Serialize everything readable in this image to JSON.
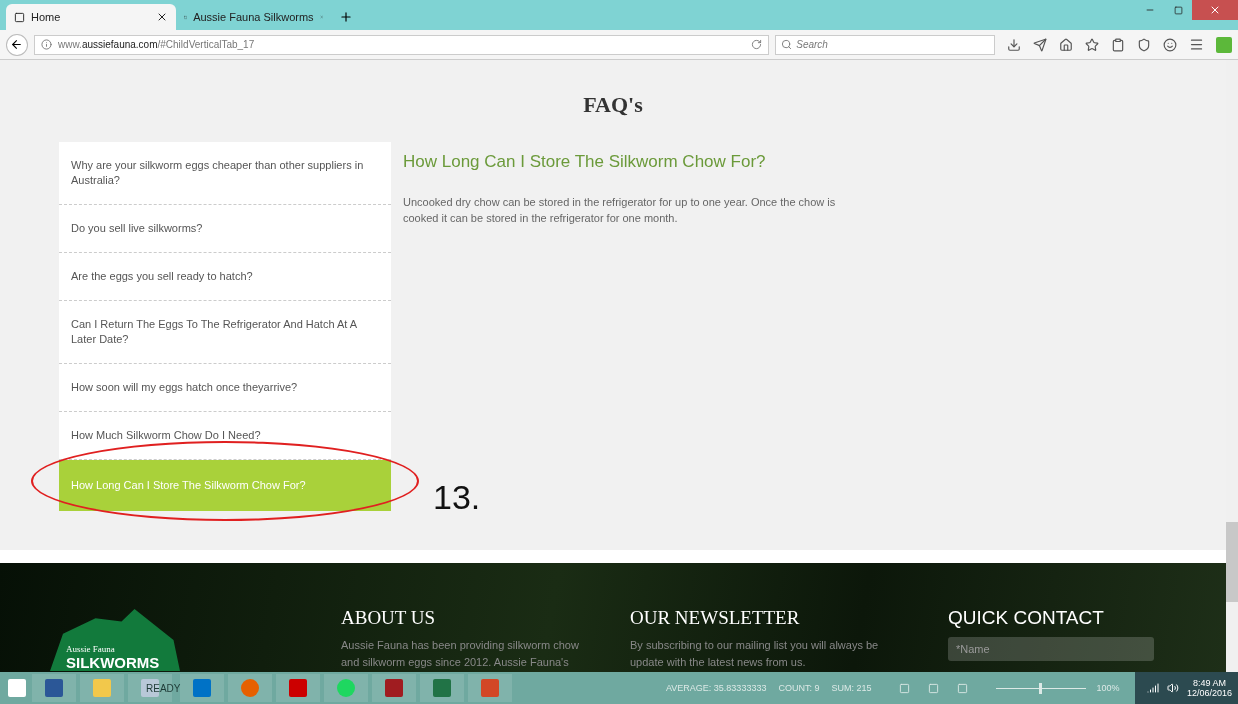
{
  "browser": {
    "tabs": [
      {
        "label": "Home",
        "selected": true
      },
      {
        "label": "Aussie Fauna Silkworms",
        "selected": false
      }
    ],
    "url_host": "www.",
    "url_domain": "aussiefauna.com",
    "url_path": "/#ChildVerticalTab_17",
    "search": {
      "placeholder": "Search"
    }
  },
  "faq": {
    "title": "FAQ's",
    "questions": [
      {
        "label": "Why are your silkworm eggs cheaper than other suppliers in Australia?",
        "selected": false
      },
      {
        "label": "Do you sell live silkworms?",
        "selected": false
      },
      {
        "label": "Are the eggs you sell ready to hatch?",
        "selected": false
      },
      {
        "label": "Can I Return The Eggs To The Refrigerator And Hatch At A Later Date?",
        "selected": false
      },
      {
        "label": "How soon will my eggs hatch once theyarrive?",
        "selected": false
      },
      {
        "label": "How Much Silkworm Chow Do I Need?",
        "selected": false
      },
      {
        "label": "How Long Can I Store The Silkworm Chow For?",
        "selected": true
      }
    ],
    "answer_title": "How Long Can I Store The Silkworm Chow For?",
    "answer": "Uncooked dry chow can be stored in the refrigerator for up to one year. Once the chow is cooked it can be stored in the refrigerator for one month."
  },
  "annotation": {
    "label": "13."
  },
  "footer": {
    "logo_small": "Aussie Fauna",
    "logo_big": "SILKWORMS",
    "about_title": "ABOUT US",
    "about_text": "Aussie Fauna has been providing silkworm chow and silkworm eggs since 2012. Aussie Fauna's",
    "newsletter_title": "OUR NEWSLETTER",
    "newsletter_text": "By subscribing to our mailing list you will always be update with the latest news from us.",
    "contact_title": "QUICK CONTACT",
    "name_placeholder": "*Name"
  },
  "taskbar": {
    "excel_ready": "READY",
    "stats": [
      "AVERAGE: 35.83333333",
      "COUNT: 9",
      "SUM: 215"
    ],
    "zoom_slider": {
      "level": 0.5
    },
    "zoom": "100%",
    "time": "8:49 AM",
    "date": "12/06/2016"
  }
}
